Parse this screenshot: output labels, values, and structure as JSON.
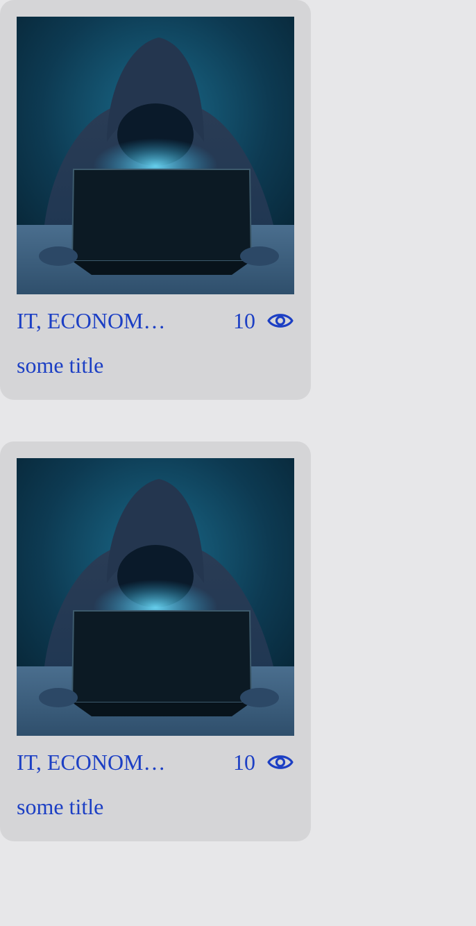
{
  "colors": {
    "page_background": "#e7e7e9",
    "card_background": "#d5d5d7",
    "accent_text": "#1c3fc4"
  },
  "feed": {
    "cards": [
      {
        "image": "hooded-hacker-at-laptop",
        "category": "IT, ECONOMICS",
        "views": "10",
        "views_icon": "eye-icon",
        "title": "some title"
      },
      {
        "image": "hooded-hacker-at-laptop",
        "category": "IT, ECONOMICS",
        "views": "10",
        "views_icon": "eye-icon",
        "title": "some title"
      }
    ]
  }
}
